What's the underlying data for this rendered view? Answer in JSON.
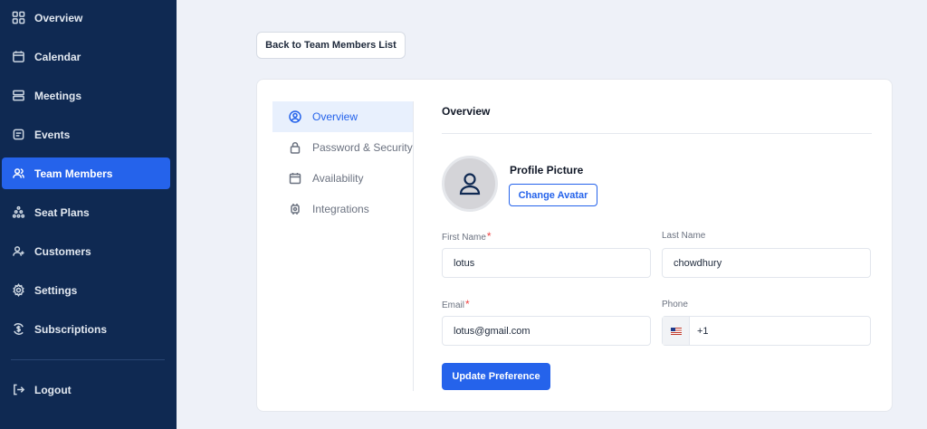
{
  "sidebar": {
    "items": [
      {
        "label": "Overview",
        "icon": "grid-icon"
      },
      {
        "label": "Calendar",
        "icon": "calendar-icon"
      },
      {
        "label": "Meetings",
        "icon": "meetings-icon"
      },
      {
        "label": "Events",
        "icon": "events-icon"
      },
      {
        "label": "Team Members",
        "icon": "team-icon",
        "active": true
      },
      {
        "label": "Seat Plans",
        "icon": "seat-plans-icon"
      },
      {
        "label": "Customers",
        "icon": "customers-icon"
      },
      {
        "label": "Settings",
        "icon": "gear-icon"
      },
      {
        "label": "Subscriptions",
        "icon": "subscriptions-icon"
      }
    ],
    "logout_label": "Logout"
  },
  "back_button_label": "Back to Team Members List",
  "subnav": {
    "items": [
      {
        "label": "Overview",
        "icon": "user-circle-icon",
        "active": true
      },
      {
        "label": "Password & Security",
        "icon": "lock-icon"
      },
      {
        "label": "Availability",
        "icon": "calendar-icon"
      },
      {
        "label": "Integrations",
        "icon": "chip-icon"
      }
    ]
  },
  "overview": {
    "title": "Overview",
    "profile_picture_label": "Profile Picture",
    "change_avatar_label": "Change Avatar",
    "first_name": {
      "label": "First Name",
      "required_mark": "*",
      "value": "lotus"
    },
    "last_name": {
      "label": "Last Name",
      "value": "chowdhury"
    },
    "email": {
      "label": "Email",
      "required_mark": "*",
      "value": "lotus@gmail.com"
    },
    "phone": {
      "label": "Phone",
      "country": "US",
      "value": "+1"
    },
    "update_button_label": "Update Preference"
  },
  "colors": {
    "sidebar_bg": "#0f2952",
    "accent": "#2563eb",
    "page_bg": "#eef1f8",
    "required": "#ef4444"
  }
}
